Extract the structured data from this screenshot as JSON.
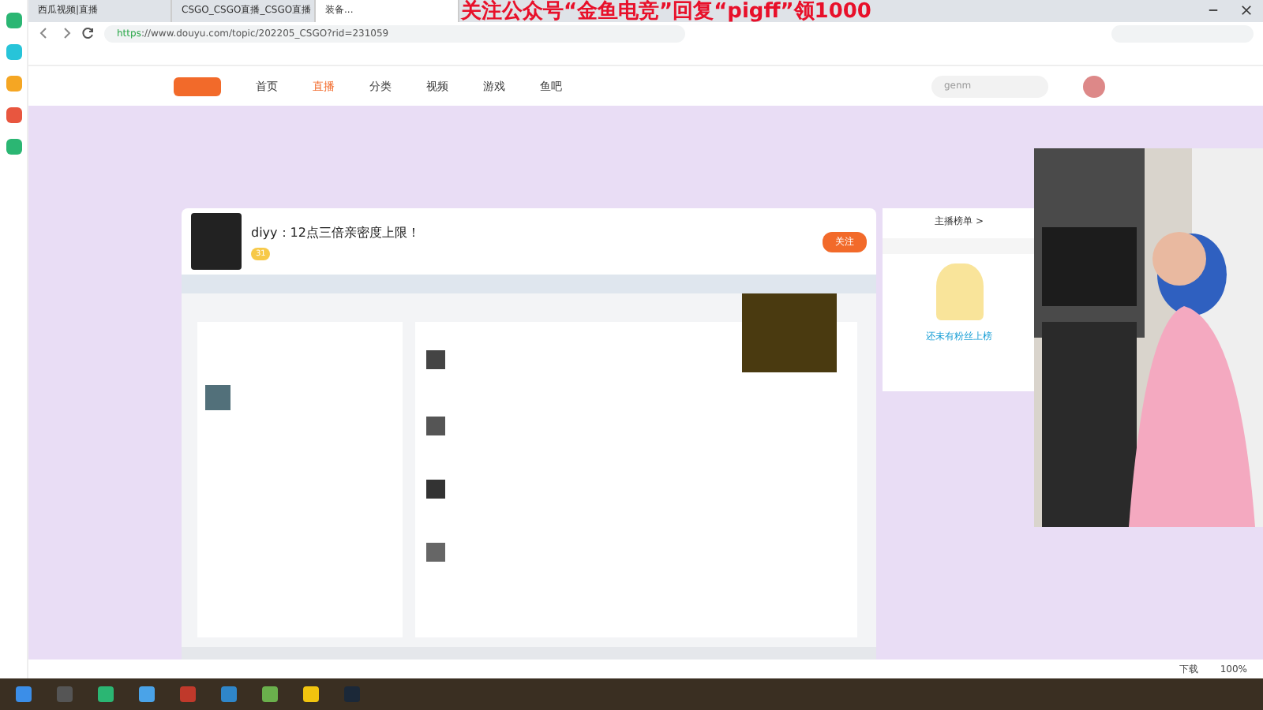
{
  "overlay_banner": "关注公众号“金鱼电竞”回复“pigff”领1000",
  "browser": {
    "tabs": [
      {
        "label": "西瓜视频|直播",
        "selected": false
      },
      {
        "label": "CSGO_CSGO直播_CSGO直播",
        "selected": false
      },
      {
        "label": "装备...",
        "selected": true
      }
    ],
    "url_scheme": "https",
    "url_rest": "://www.douyu.com/topic/202205_CSGO?rid=231059",
    "zoom": "100%",
    "download": "下载"
  },
  "site": {
    "nav": [
      {
        "label": "首页",
        "selected": false
      },
      {
        "label": "直播",
        "selected": true
      },
      {
        "label": "分类",
        "selected": false
      },
      {
        "label": "视频",
        "selected": false
      },
      {
        "label": "游戏",
        "selected": false
      },
      {
        "label": "鱼吧",
        "selected": false
      }
    ],
    "search": {
      "value": "genm"
    }
  },
  "room": {
    "title": "diyy：12点三倍亲密度上限！",
    "level": "31",
    "follow": "关注"
  },
  "panel": {
    "rank_title": "主播榜单 >",
    "empty": "还未有粉丝上榜"
  }
}
